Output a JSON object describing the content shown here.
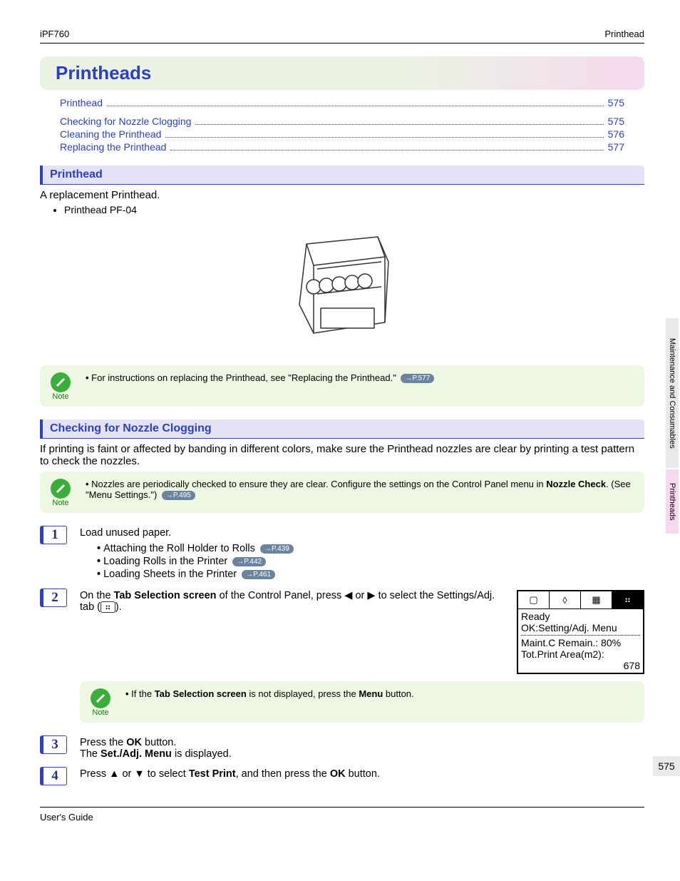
{
  "header": {
    "left": "iPF760",
    "right": "Printhead"
  },
  "banner_title": "Printheads",
  "toc": [
    {
      "label": "Printhead",
      "page": "575"
    },
    {
      "label": "Checking for Nozzle Clogging",
      "page": "575"
    },
    {
      "label": "Cleaning the Printhead",
      "page": "576"
    },
    {
      "label": "Replacing the Printhead",
      "page": "577"
    }
  ],
  "sec_printhead": {
    "title": "Printhead",
    "intro": "A replacement Printhead.",
    "item": "Printhead PF-04",
    "note_text": "For instructions on replacing the Printhead, see \"Replacing the Printhead.\"",
    "note_ref": "→P.577"
  },
  "sec_nozzle": {
    "title": "Checking for Nozzle Clogging",
    "intro": "If printing is faint or affected by banding in different colors, make sure the Printhead nozzles are clear by printing a test pattern to check the nozzles.",
    "note_pre": "Nozzles are periodically checked to ensure they are clear. Configure the settings on the Control Panel menu in ",
    "note_bold": "Nozzle Check",
    "note_post": ". (See \"Menu Settings.\")",
    "note_ref": "→P.495"
  },
  "steps": {
    "s1": {
      "text": "Load unused paper.",
      "b1": "Attaching the Roll Holder to Rolls",
      "r1": "→P.439",
      "b2": "Loading Rolls in the Printer",
      "r2": "→P.442",
      "b3": "Loading Sheets in the Printer",
      "r3": "→P.461"
    },
    "s2": {
      "pre": "On the ",
      "bold1": "Tab Selection screen",
      "mid": " of the Control Panel, press ◀ or ▶ to select the Settings/Adj. tab (",
      "icon": "⠶",
      "post": ")."
    },
    "panel": {
      "t1": "▢",
      "t2": "◊",
      "t3": "▦",
      "t4": "⠶",
      "l1": "Ready",
      "l2": "OK:Setting/Adj. Menu",
      "l3": "Maint.C Remain.: 80%",
      "l4": "Tot.Print Area(m2):",
      "l5": "678"
    },
    "s2note_pre": "If the ",
    "s2note_b1": "Tab Selection screen",
    "s2note_mid": " is not displayed, press the ",
    "s2note_b2": "Menu",
    "s2note_post": " button.",
    "s3": {
      "l1a": "Press the ",
      "l1b": "OK",
      "l1c": " button.",
      "l2a": "The ",
      "l2b": "Set./Adj. Menu",
      "l2c": " is displayed."
    },
    "s4": {
      "a": "Press ▲ or ▼ to select ",
      "b": "Test Print",
      "c": ", and then press the ",
      "d": "OK",
      "e": " button."
    }
  },
  "sidebar": {
    "tab1": "Maintenance and Consumables",
    "tab2": "Printheads"
  },
  "pagenum": "575",
  "footer": {
    "left": "User's Guide",
    "right": ""
  },
  "labels": {
    "note": "Note"
  }
}
